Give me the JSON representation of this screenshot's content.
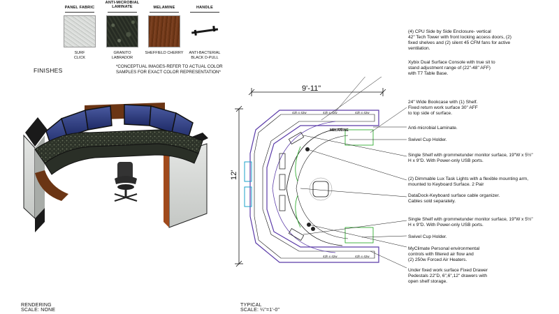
{
  "finishes": {
    "title": "FINISHES",
    "swatches": [
      {
        "header": "PANEL FABRIC",
        "label_line1": "SURF",
        "label_line2": "CLICK",
        "color": "#cfd2cf"
      },
      {
        "header_line1": "ANTI-MICROBIAL",
        "header_line2": "LAMINATE",
        "label_line1": "GRANITO",
        "label_line2": "LABRADOR",
        "color": "#2a3028"
      },
      {
        "header": "MELAMINE",
        "label_line1": "SHEFFIELD CHERRY",
        "label_line2": "",
        "color": "#6b3514"
      },
      {
        "header": "HANDLE",
        "label_line1": "ANTI-BACTERIAL",
        "label_line2": "BLACK D-PULL",
        "color": "#ffffff"
      }
    ],
    "note_line1": "*CONCEPTUAL IMAGES-REFER TO ACTUAL COLOR",
    "note_line2": "SAMPLES FOR EXACT COLOR REPRESENTATION*"
  },
  "rendering": {
    "caption_line1": "RENDERING",
    "caption_line2": "SCALE: NONE"
  },
  "plan": {
    "width_dim": "9'-11\"",
    "height_dim": "12'",
    "caption_line1": "TYPICAL",
    "caption_line2": "SCALE: ¼\"=1'-0\"",
    "melamine_tag": "MELAMINE",
    "small_labels": [
      "42h x 42w",
      "42h x 42w",
      "42h x 42w",
      "42h x 42w",
      "42h x 42w"
    ]
  },
  "callouts": [
    {
      "l1": "(4) CPU Side by Side Enclosure- vertical",
      "l2": "42\" Tech Tower with front locking access doors, (2)",
      "l3": "fixed shelves and (2) silent 45 CFM fans for active",
      "l4": "ventilation."
    },
    {
      "l1": "Xybix Dual Surface Console with true sit to",
      "l2": "stand adjustment range of (22\"-48\" AFF)",
      "l3": "with T7 Table Base.",
      "l4": ""
    },
    {
      "l1": "24\" Wide Bookcase with (1) Shelf.",
      "l2": "Fixed return work surface 30\" AFF",
      "l3": "to top side of surface.",
      "l4": ""
    },
    {
      "l1": "Anti-microbial Laminate.",
      "l2": "",
      "l3": "",
      "l4": ""
    },
    {
      "l1": "Swivel Cup Holder.",
      "l2": "",
      "l3": "",
      "l4": ""
    },
    {
      "l1": "Single Shelf with grommetunder monitor surface, 19\"W x 5½\"",
      "l2": "H x 9\"D. With Power-only USB ports.",
      "l3": "",
      "l4": ""
    },
    {
      "l1": "(2) Dimmable Lux Task Lights with a flexible mounting arm,",
      "l2": "mounted to Keyboard Surface. 2 Pair",
      "l3": "",
      "l4": ""
    },
    {
      "l1": "DataDock-Keyboard surface cable organizer.",
      "l2": "Cables sold separately.",
      "l3": "",
      "l4": ""
    },
    {
      "l1": "Single Shelf with grommetunder monitor surface, 19\"W x 5½\"",
      "l2": "H x 9\"D. With Power-only USB ports.",
      "l3": "",
      "l4": ""
    },
    {
      "l1": "Swivel Cup Holder.",
      "l2": "",
      "l3": "",
      "l4": ""
    },
    {
      "l1": "MyClimate Personal environmental",
      "l2": "controls with filtered air flow and",
      "l3": "(2) 250w Forced Air Heaters.",
      "l4": ""
    },
    {
      "l1": "Under fixed work surface Fixed Drawer",
      "l2": "Pedestals 22\"D, 6\",6\",12\" drawers with",
      "l3": "open shelf storage.",
      "l4": ""
    }
  ]
}
